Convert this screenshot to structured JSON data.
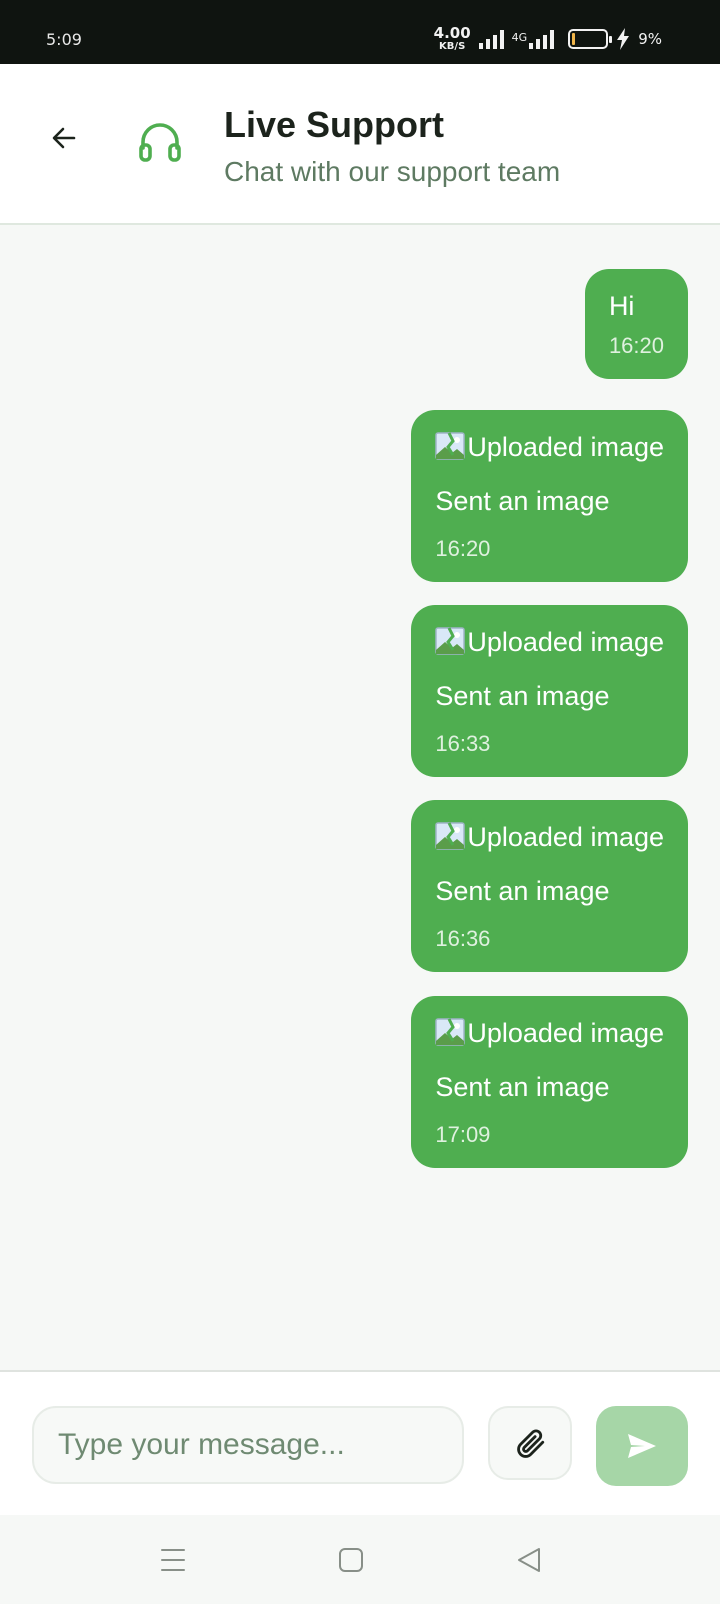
{
  "status_bar": {
    "time": "5:09",
    "net_speed": "4.00",
    "net_unit": "KB/S",
    "network_label": "4G",
    "battery_percent": "9%",
    "battery_level": 0.09
  },
  "header": {
    "title": "Live Support",
    "subtitle": "Chat with our support team",
    "back_icon": "arrow-left-icon",
    "support_icon": "headset-icon"
  },
  "messages": [
    {
      "type": "text",
      "text": "Hi",
      "time": "16:20"
    },
    {
      "type": "image",
      "alt": "Uploaded image",
      "caption": "Sent an image",
      "time": "16:20"
    },
    {
      "type": "image",
      "alt": "Uploaded image",
      "caption": "Sent an image",
      "time": "16:33"
    },
    {
      "type": "image",
      "alt": "Uploaded image",
      "caption": "Sent an image",
      "time": "16:36"
    },
    {
      "type": "image",
      "alt": "Uploaded image",
      "caption": "Sent an image",
      "time": "17:09"
    }
  ],
  "input": {
    "placeholder": "Type your message...",
    "value": "",
    "attach_icon": "paperclip-icon",
    "send_icon": "send-icon"
  },
  "nav": {
    "menu_icon": "menu-icon",
    "home_icon": "home-icon",
    "back_icon": "back-triangle-icon"
  },
  "colors": {
    "accent": "#4fae50",
    "accent_light": "#a6d6a7",
    "status_bar": "#0f1410",
    "background": "#f6f8f6",
    "subtitle": "#5e7a62"
  }
}
